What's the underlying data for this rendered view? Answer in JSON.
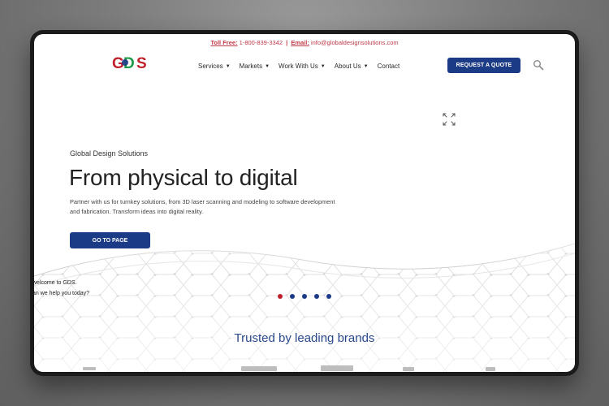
{
  "topbar": {
    "toll_label": "Toll Free:",
    "toll_value": "1-800-839-3342",
    "separator": "|",
    "email_label": "Email:",
    "email_value": "info@globaldesignsolutions.com"
  },
  "logo": {
    "text": "GDS"
  },
  "nav": {
    "items": [
      {
        "label": "Services",
        "dropdown": true
      },
      {
        "label": "Markets",
        "dropdown": true
      },
      {
        "label": "Work With Us",
        "dropdown": true
      },
      {
        "label": "About Us",
        "dropdown": true
      },
      {
        "label": "Contact",
        "dropdown": false
      }
    ],
    "chevron_glyph": "▼",
    "cta_label": "REQUEST A QUOTE",
    "search_icon": "search-icon"
  },
  "hero": {
    "eyebrow": "Global Design Solutions",
    "headline": "From physical to digital",
    "description": "Partner with us for turnkey solutions, from 3D laser scanning and modeling to software development and fabrication. Transform ideas into digital reality.",
    "button_label": "GO TO PAGE",
    "expand_icon": "expand-icon",
    "slides": 5,
    "active_slide": 1
  },
  "chat": {
    "line1": "welcome to GDS.",
    "line2": "an we help you today?"
  },
  "trusted": {
    "heading": "Trusted by leading brands"
  },
  "colors": {
    "primary": "#1c3b86",
    "accent": "#c03a48",
    "active_dot": "#c0202c",
    "text": "#222222"
  }
}
